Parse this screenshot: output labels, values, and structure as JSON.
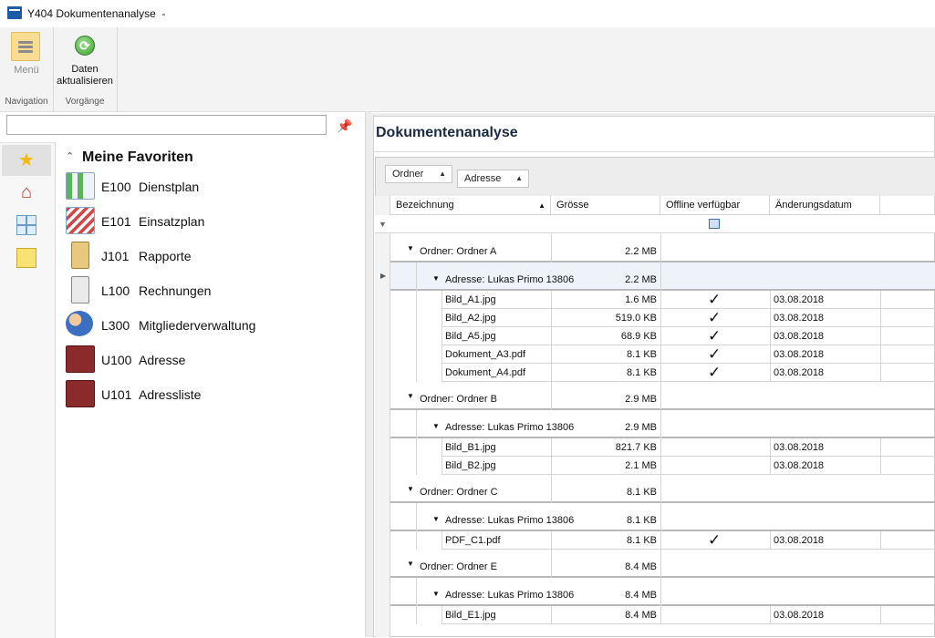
{
  "window": {
    "title": "Y404 Dokumentenanalyse  -"
  },
  "ribbon": {
    "menu_label": "Menü",
    "refresh_label_1": "Daten",
    "refresh_label_2": "aktualisieren",
    "group_navigation": "Navigation",
    "group_vorgaenge": "Vorgänge"
  },
  "search": {
    "placeholder": ""
  },
  "favorites": {
    "header": "Meine Favoriten",
    "items": [
      {
        "code": "E100",
        "name": "Dienstplan"
      },
      {
        "code": "E101",
        "name": "Einsatzplan"
      },
      {
        "code": "J101",
        "name": "Rapporte"
      },
      {
        "code": "L100",
        "name": "Rechnungen"
      },
      {
        "code": "L300",
        "name": "Mitgliederverwaltung"
      },
      {
        "code": "U100",
        "name": "Adresse"
      },
      {
        "code": "U101",
        "name": "Adressliste"
      }
    ]
  },
  "panel": {
    "title": "Dokumentenanalyse"
  },
  "grouping": {
    "chip1": "Ordner",
    "chip2": "Adresse"
  },
  "columns": [
    "Bezeichnung",
    "Grösse",
    "Offline verfügbar",
    "Änderungsdatum"
  ],
  "rows": [
    {
      "kind": "ordner",
      "label": "Ordner: Ordner A",
      "size": "2.2 MB"
    },
    {
      "kind": "adresse",
      "label": "Adresse: Lukas Primo 13806",
      "size": "2.2 MB",
      "focused": true
    },
    {
      "kind": "data",
      "name": "Bild_A1.jpg",
      "size": "1.6 MB",
      "offline": true,
      "date": "03.08.2018"
    },
    {
      "kind": "data",
      "name": "Bild_A2.jpg",
      "size": "519.0 KB",
      "offline": true,
      "date": "03.08.2018"
    },
    {
      "kind": "data",
      "name": "Bild_A5.jpg",
      "size": "68.9 KB",
      "offline": true,
      "date": "03.08.2018"
    },
    {
      "kind": "data",
      "name": "Dokument_A3.pdf",
      "size": "8.1 KB",
      "offline": true,
      "date": "03.08.2018"
    },
    {
      "kind": "data",
      "name": "Dokument_A4.pdf",
      "size": "8.1 KB",
      "offline": true,
      "date": "03.08.2018"
    },
    {
      "kind": "ordner",
      "label": "Ordner: Ordner B",
      "size": "2.9 MB"
    },
    {
      "kind": "adresse",
      "label": "Adresse: Lukas Primo 13806",
      "size": "2.9 MB"
    },
    {
      "kind": "data",
      "name": "Bild_B1.jpg",
      "size": "821.7 KB",
      "offline": false,
      "date": "03.08.2018"
    },
    {
      "kind": "data",
      "name": "Bild_B2.jpg",
      "size": "2.1 MB",
      "offline": false,
      "date": "03.08.2018"
    },
    {
      "kind": "ordner",
      "label": "Ordner: Ordner C",
      "size": "8.1 KB"
    },
    {
      "kind": "adresse",
      "label": "Adresse: Lukas Primo 13806",
      "size": "8.1 KB"
    },
    {
      "kind": "data",
      "name": "PDF_C1.pdf",
      "size": "8.1 KB",
      "offline": true,
      "date": "03.08.2018"
    },
    {
      "kind": "ordner",
      "label": "Ordner: Ordner E",
      "size": "8.4 MB"
    },
    {
      "kind": "adresse",
      "label": "Adresse: Lukas Primo 13806",
      "size": "8.4 MB"
    },
    {
      "kind": "data",
      "name": "Bild_E1.jpg",
      "size": "8.4 MB",
      "offline": false,
      "date": "03.08.2018"
    }
  ]
}
